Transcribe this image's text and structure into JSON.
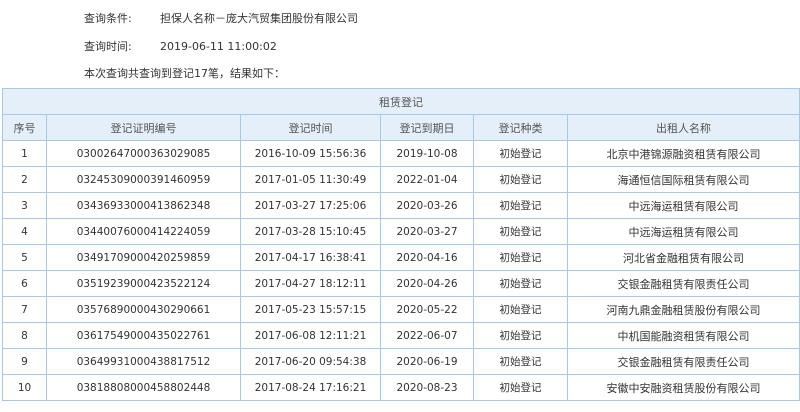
{
  "query": {
    "condition_label": "查询条件:",
    "condition_value": "担保人名称－庞大汽贸集团股份有限公司",
    "time_label": "查询时间:",
    "time_value": "2019-06-11 11:00:02",
    "summary": "本次查询共查询到登记17笔，结果如下："
  },
  "table": {
    "caption": "租赁登记",
    "headers": [
      "序号",
      "登记证明编号",
      "登记时间",
      "登记到期日",
      "登记种类",
      "出租人名称"
    ],
    "rows": [
      [
        "1",
        "03002647000363029085",
        "2016-10-09 15:56:36",
        "2019-10-08",
        "初始登记",
        "北京中港锦源融资租赁有限公司"
      ],
      [
        "2",
        "03245309000391460959",
        "2017-01-05 11:30:49",
        "2022-01-04",
        "初始登记",
        "海通恒信国际租赁有限公司"
      ],
      [
        "3",
        "03436933000413862348",
        "2017-03-27 17:25:06",
        "2020-03-26",
        "初始登记",
        "中远海运租赁有限公司"
      ],
      [
        "4",
        "03440076000414224059",
        "2017-03-28 15:10:45",
        "2020-03-27",
        "初始登记",
        "中远海运租赁有限公司"
      ],
      [
        "5",
        "03491709000420259859",
        "2017-04-17 16:38:41",
        "2020-04-16",
        "初始登记",
        "河北省金融租赁有限公司"
      ],
      [
        "6",
        "03519239000423522124",
        "2017-04-27 18:12:11",
        "2020-04-26",
        "初始登记",
        "交银金融租赁有限责任公司"
      ],
      [
        "7",
        "03576890000430290661",
        "2017-05-23 15:57:15",
        "2020-05-22",
        "初始登记",
        "河南九鼎金融租赁股份有限公司"
      ],
      [
        "8",
        "03617549000435022761",
        "2017-06-08 12:11:21",
        "2022-06-07",
        "初始登记",
        "中机国能融资租赁有限公司"
      ],
      [
        "9",
        "03649931000438817512",
        "2017-06-20 09:54:38",
        "2020-06-19",
        "初始登记",
        "交银金融租赁有限责任公司"
      ],
      [
        "10",
        "03818808000458802448",
        "2017-08-24 17:16:21",
        "2020-08-23",
        "初始登记",
        "安徽中安融资租赁股份有限公司"
      ]
    ]
  }
}
